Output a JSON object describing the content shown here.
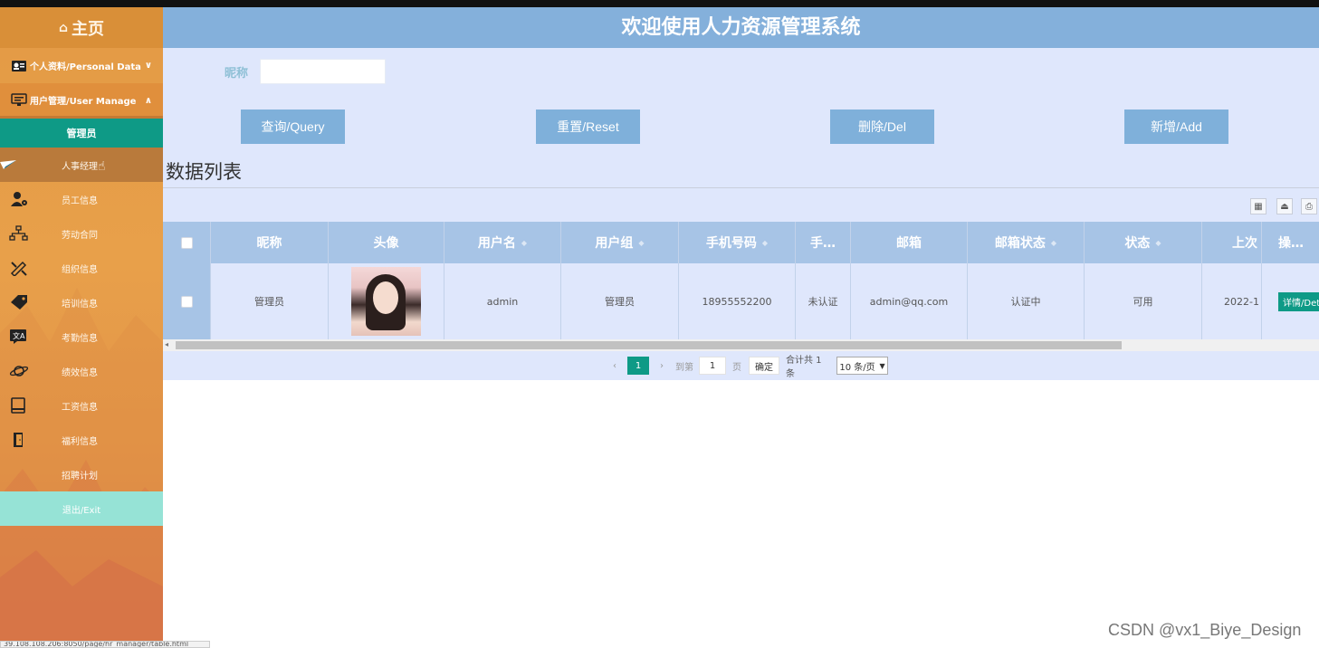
{
  "sidebar": {
    "home_label": "主页",
    "groups": [
      {
        "label": "个人资料/Personal Data",
        "icon": "personal-card-icon",
        "chevron": "∨"
      },
      {
        "label": "用户管理/User Manage",
        "icon": "monitor-icon",
        "chevron": "∧"
      }
    ],
    "active_item": "管理员",
    "items": [
      {
        "label": "人事经理",
        "icon": "paper-plane-icon"
      },
      {
        "label": "员工信息",
        "icon": "user-gear-icon"
      },
      {
        "label": "劳动合同",
        "icon": "org-chart-icon"
      },
      {
        "label": "组织信息",
        "icon": "tools-icon"
      },
      {
        "label": "培训信息",
        "icon": "tag-icon"
      },
      {
        "label": "考勤信息",
        "icon": "translate-icon"
      },
      {
        "label": "绩效信息",
        "icon": "planet-icon"
      },
      {
        "label": "工资信息",
        "icon": "book-icon"
      },
      {
        "label": "福利信息",
        "icon": "door-icon"
      },
      {
        "label": "招聘计划",
        "icon": ""
      }
    ],
    "exit_label": "退出/Exit"
  },
  "header": {
    "title": "欢迎使用人力资源管理系统"
  },
  "search": {
    "label": "昵称",
    "value": ""
  },
  "buttons": {
    "query": "查询/Query",
    "reset": "重置/Reset",
    "delete": "删除/Del",
    "add": "新增/Add"
  },
  "list_title": "数据列表",
  "table": {
    "columns": [
      "昵称",
      "头像",
      "用户名",
      "用户组",
      "手机号码",
      "手…",
      "邮箱",
      "邮箱状态",
      "状态",
      "上次",
      "操…"
    ],
    "rows": [
      {
        "nickname": "管理员",
        "username": "admin",
        "group": "管理员",
        "phone": "18955552200",
        "phone_status": "未认证",
        "email": "admin@qq.com",
        "email_status": "认证中",
        "status": "可用",
        "last": "2022-1",
        "action": "详情/Deta"
      }
    ]
  },
  "pager": {
    "prev": "‹",
    "current": "1",
    "next": "›",
    "goto_label": "到第",
    "goto_value": "1",
    "page_unit": "页",
    "confirm": "确定",
    "total": "合计共 1 条",
    "page_size": "10 条/页"
  },
  "statusbar": {
    "url": "39.108.108.206:8050/page/hr_manager/table.html"
  },
  "watermark": "CSDN @vx1_Biye_Design",
  "colors": {
    "accent": "#0e9a86",
    "header": "#84b0db",
    "sidebar": "#e39a45",
    "button": "#7fb0da"
  }
}
